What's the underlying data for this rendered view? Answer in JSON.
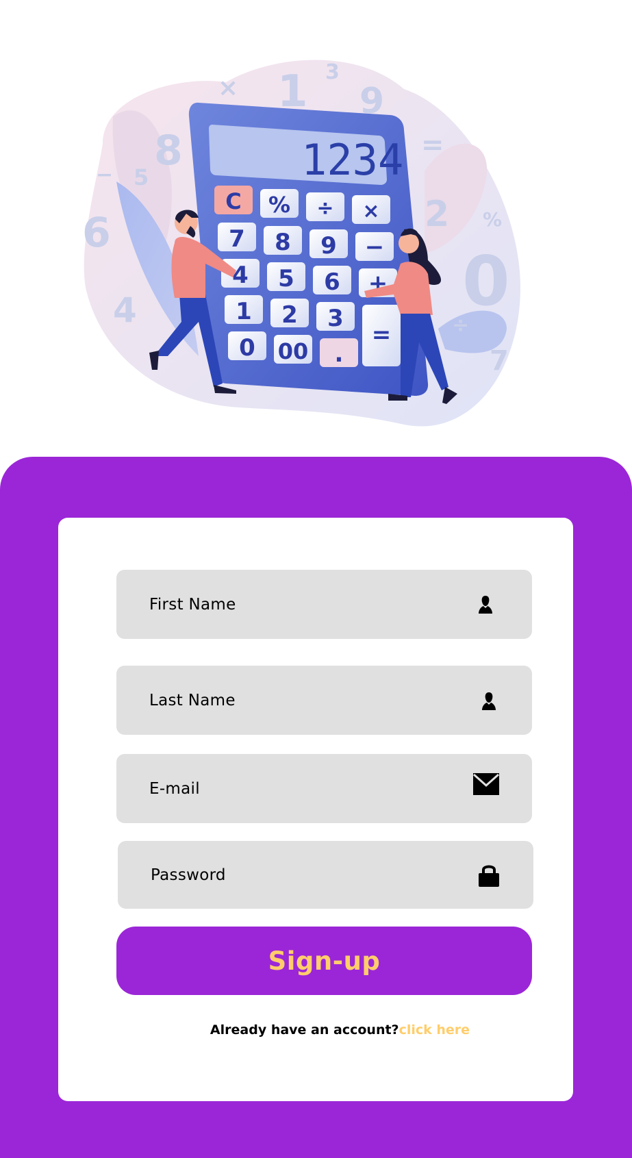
{
  "illustration": {
    "display_value": "1234",
    "keys": [
      "C",
      "%",
      "÷",
      "×",
      "7",
      "8",
      "9",
      "−",
      "4",
      "5",
      "6",
      "+",
      "1",
      "2",
      "3",
      "=",
      "0",
      "00",
      "."
    ]
  },
  "form": {
    "fields": [
      {
        "label": "First Name",
        "icon": "user-icon"
      },
      {
        "label": "Last Name",
        "icon": "user-icon"
      },
      {
        "label": "E-mail",
        "icon": "envelope-icon"
      },
      {
        "label": "Password",
        "icon": "lock-icon"
      }
    ],
    "submit_label": "Sign-up",
    "account_prompt": "Already have an account?",
    "account_link": "click here"
  },
  "colors": {
    "accent": "#9b26d7",
    "highlight": "#ffcd6b",
    "field_bg": "#e0e0e0"
  }
}
